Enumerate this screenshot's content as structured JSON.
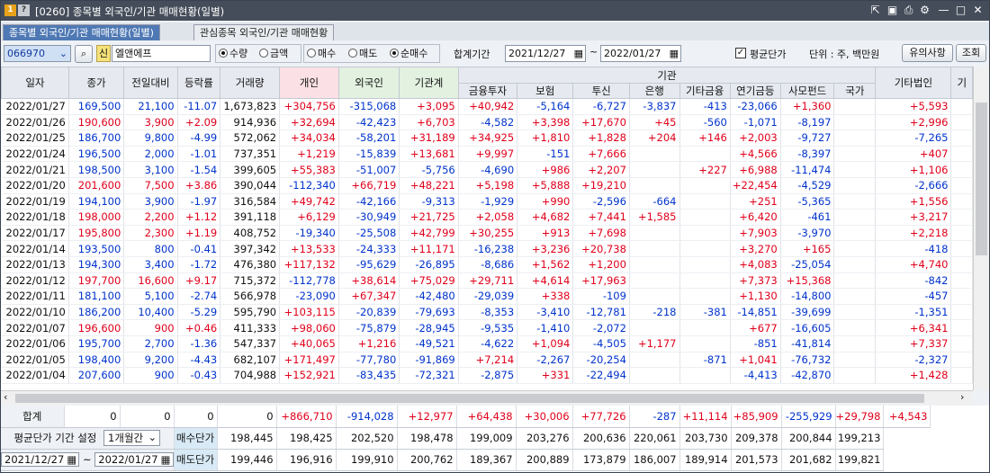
{
  "window": {
    "title": "[0260] 종목별 외국인/기관 매매현황(일별)",
    "badge1": "1",
    "badge2": "?"
  },
  "tabs": [
    "종목별 외국인/기관 매매현황(일별)",
    "관심종목 외국인/기관 매매현황"
  ],
  "toolbar": {
    "code": "066970",
    "name_prefix": "신",
    "name": "엘앤에프",
    "radios": [
      {
        "label": "수량",
        "on": true
      },
      {
        "label": "금액",
        "on": false
      },
      {
        "label": "매수",
        "on": false
      },
      {
        "label": "매도",
        "on": false
      },
      {
        "label": "순매수",
        "on": true
      }
    ],
    "period_label": "합계기간",
    "start": "2021/12/27",
    "tilde": "~",
    "end": "2022/01/27",
    "avg_check_label": "평균단가",
    "unit": "단위 : 주, 백만원",
    "notice_btn": "유의사항",
    "query_btn": "조회"
  },
  "header": {
    "cols": [
      "일자",
      "종가",
      "전일대비",
      "등락률",
      "거래량",
      "개인",
      "외국인",
      "기관계"
    ],
    "group": "기관",
    "subcols": [
      "금융투자",
      "보험",
      "투신",
      "은행",
      "기타금융",
      "연기금등",
      "사모펀드",
      "국가"
    ],
    "tail": [
      "기타법인",
      "기"
    ]
  },
  "rows": [
    [
      "2022/01/27",
      "169,500",
      "21,100",
      "-11.07",
      "1,673,823",
      "+304,756",
      "-315,068",
      "+3,095",
      "+40,942",
      "-5,164",
      "-6,727",
      "-3,837",
      "-413",
      "-23,066",
      "+1,360",
      "",
      "+5,593"
    ],
    [
      "2022/01/26",
      "190,600",
      "3,900",
      "+2.09",
      "914,936",
      "+32,694",
      "-42,423",
      "+6,703",
      "-4,582",
      "+3,398",
      "+17,670",
      "+45",
      "-560",
      "-1,071",
      "-8,197",
      "",
      "+2,996"
    ],
    [
      "2022/01/25",
      "186,700",
      "9,800",
      "-4.99",
      "572,062",
      "+34,034",
      "-58,201",
      "+31,189",
      "+34,925",
      "+1,810",
      "+1,828",
      "+204",
      "+146",
      "+2,003",
      "-9,727",
      "",
      "-7,265"
    ],
    [
      "2022/01/24",
      "196,500",
      "2,000",
      "-1.01",
      "737,351",
      "+1,219",
      "-15,839",
      "+13,681",
      "+9,997",
      "-151",
      "+7,666",
      "",
      "",
      "+4,566",
      "-8,397",
      "",
      "+407"
    ],
    [
      "2022/01/21",
      "198,500",
      "3,100",
      "-1.54",
      "399,605",
      "+55,383",
      "-51,007",
      "-5,756",
      "-4,690",
      "+986",
      "+2,207",
      "",
      "+227",
      "+6,988",
      "-11,474",
      "",
      "+1,106"
    ],
    [
      "2022/01/20",
      "201,600",
      "7,500",
      "+3.86",
      "390,044",
      "-112,340",
      "+66,719",
      "+48,221",
      "+5,198",
      "+5,888",
      "+19,210",
      "",
      "",
      "+22,454",
      "-4,529",
      "",
      "-2,666"
    ],
    [
      "2022/01/19",
      "194,100",
      "3,900",
      "-1.97",
      "316,584",
      "+49,742",
      "-42,166",
      "-9,313",
      "-1,929",
      "+990",
      "-2,596",
      "-664",
      "",
      "+251",
      "-5,365",
      "",
      "+1,556"
    ],
    [
      "2022/01/18",
      "198,000",
      "2,200",
      "+1.12",
      "391,118",
      "+6,129",
      "-30,949",
      "+21,725",
      "+2,058",
      "+4,682",
      "+7,441",
      "+1,585",
      "",
      "+6,420",
      "-461",
      "",
      "+3,217"
    ],
    [
      "2022/01/17",
      "195,800",
      "2,300",
      "+1.19",
      "408,752",
      "-19,340",
      "-25,508",
      "+42,799",
      "+30,255",
      "+913",
      "+7,698",
      "",
      "",
      "+7,903",
      "-3,970",
      "",
      "+2,218"
    ],
    [
      "2022/01/14",
      "193,500",
      "800",
      "-0.41",
      "397,342",
      "+13,533",
      "-24,333",
      "+11,171",
      "-16,238",
      "+3,236",
      "+20,738",
      "",
      "",
      "+3,270",
      "+165",
      "",
      "-418"
    ],
    [
      "2022/01/13",
      "194,300",
      "3,400",
      "-1.72",
      "476,380",
      "+117,132",
      "-95,629",
      "-26,895",
      "-8,686",
      "+1,562",
      "+1,200",
      "",
      "",
      "+4,083",
      "-25,054",
      "",
      "+4,740"
    ],
    [
      "2022/01/12",
      "197,700",
      "16,600",
      "+9.17",
      "715,372",
      "-112,778",
      "+38,614",
      "+75,029",
      "+29,711",
      "+4,614",
      "+17,963",
      "",
      "",
      "+7,373",
      "+15,368",
      "",
      "-842"
    ],
    [
      "2022/01/11",
      "181,100",
      "5,100",
      "-2.74",
      "566,978",
      "-23,090",
      "+67,347",
      "-42,480",
      "-29,039",
      "+338",
      "-109",
      "",
      "",
      "+1,130",
      "-14,800",
      "",
      "-457"
    ],
    [
      "2022/01/10",
      "186,200",
      "10,400",
      "-5.29",
      "595,790",
      "+103,115",
      "-20,839",
      "-79,693",
      "-8,353",
      "-3,410",
      "-12,781",
      "-218",
      "-381",
      "-14,851",
      "-39,699",
      "",
      "-1,351"
    ],
    [
      "2022/01/07",
      "196,600",
      "900",
      "+0.46",
      "411,333",
      "+98,060",
      "-75,879",
      "-28,945",
      "-9,535",
      "-1,410",
      "-2,072",
      "",
      "",
      "+677",
      "-16,605",
      "",
      "+6,341"
    ],
    [
      "2022/01/06",
      "195,700",
      "2,700",
      "-1.36",
      "547,337",
      "+40,065",
      "+1,216",
      "-49,521",
      "-4,622",
      "+1,094",
      "-4,505",
      "+1,177",
      "",
      "-851",
      "-41,814",
      "",
      "+7,337"
    ],
    [
      "2022/01/05",
      "198,400",
      "9,200",
      "-4.43",
      "682,107",
      "+171,497",
      "-77,780",
      "-91,869",
      "+7,214",
      "-2,267",
      "-20,254",
      "",
      "-871",
      "+1,041",
      "-76,732",
      "",
      "-2,327"
    ],
    [
      "2022/01/04",
      "207,600",
      "900",
      "-0.43",
      "704,988",
      "+152,921",
      "-83,435",
      "-72,321",
      "-2,875",
      "+331",
      "-22,494",
      "",
      "",
      "-4,413",
      "-42,870",
      "",
      "+1,428"
    ]
  ],
  "price_dirs": [
    "down",
    "up",
    "down",
    "down",
    "down",
    "up",
    "down",
    "up",
    "up",
    "down",
    "down",
    "up",
    "down",
    "down",
    "up",
    "down",
    "down",
    "down"
  ],
  "footer": {
    "sum_label": "합계",
    "sum": [
      "0",
      "0",
      "0",
      "0",
      "+866,710",
      "-914,028",
      "+12,977",
      "+64,438",
      "+30,006",
      "+77,726",
      "-287",
      "+11,114",
      "+85,909",
      "-255,929",
      "+29,798",
      "+4,543"
    ],
    "avg_setting_label": "평균단가 기간 설정",
    "avg_period": "1개월간",
    "buy_label": "매수단가",
    "buy": [
      "198,445",
      "198,425",
      "202,520",
      "198,478",
      "199,009",
      "203,276",
      "200,636",
      "220,061",
      "203,730",
      "209,378",
      "200,844",
      "199,213"
    ],
    "start": "2021/12/27",
    "tilde": "~",
    "end": "2022/01/27",
    "sell_label": "매도단가",
    "sell": [
      "199,446",
      "196,916",
      "199,910",
      "200,762",
      "189,367",
      "200,889",
      "173,879",
      "186,007",
      "189,914",
      "201,573",
      "201,682",
      "199,821"
    ]
  }
}
